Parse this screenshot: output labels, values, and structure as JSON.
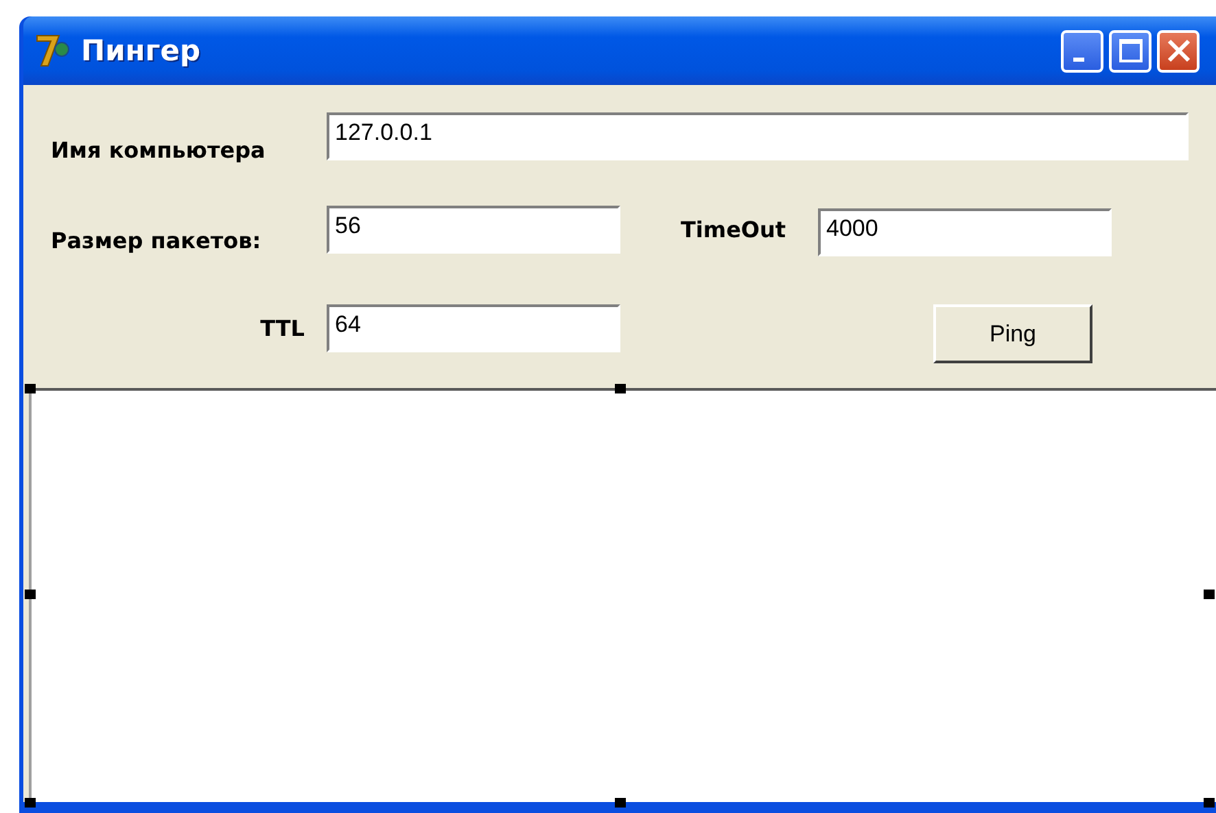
{
  "window": {
    "title": "Пингер"
  },
  "host_field": {
    "label": "Имя компьютера",
    "value": "127.0.0.1"
  },
  "packet_size_field": {
    "label": "Размер пакетов:",
    "value": "56"
  },
  "timeout_field": {
    "label": "TimeOut",
    "value": "4000"
  },
  "ttl_field": {
    "label": "TTL",
    "value": "64"
  },
  "ping_button": {
    "label": "Ping"
  }
}
